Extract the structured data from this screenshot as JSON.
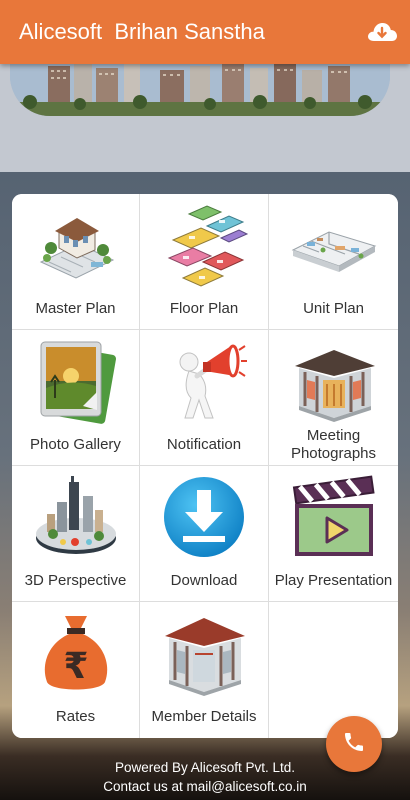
{
  "appbar": {
    "title": "Alicesoft  Brihan Sanstha",
    "action_icon": "cloud-download-icon"
  },
  "colors": {
    "accent": "#e8773a",
    "tile_background": "#ffffff",
    "label_text": "#333333"
  },
  "menu": {
    "items": [
      {
        "label": "Master Plan",
        "icon": "master-plan-icon"
      },
      {
        "label": "Floor Plan",
        "icon": "floor-plan-icon"
      },
      {
        "label": "Unit Plan",
        "icon": "unit-plan-icon"
      },
      {
        "label": "Photo Gallery",
        "icon": "photo-gallery-icon"
      },
      {
        "label": "Notification",
        "icon": "megaphone-icon"
      },
      {
        "label": "Meeting Photographs",
        "icon": "meeting-hall-icon"
      },
      {
        "label": "3D Perspective",
        "icon": "city-3d-icon"
      },
      {
        "label": "Download",
        "icon": "download-icon"
      },
      {
        "label": "Play Presentation",
        "icon": "video-play-icon"
      },
      {
        "label": "Rates",
        "icon": "rupee-bag-icon"
      },
      {
        "label": "Member Details",
        "icon": "member-hall-icon"
      }
    ]
  },
  "fab": {
    "icon": "phone-icon"
  },
  "footer": {
    "powered_by": "Powered By Alicesoft Pvt. Ltd.",
    "contact": "Contact us at mail@alicesoft.co.in"
  }
}
